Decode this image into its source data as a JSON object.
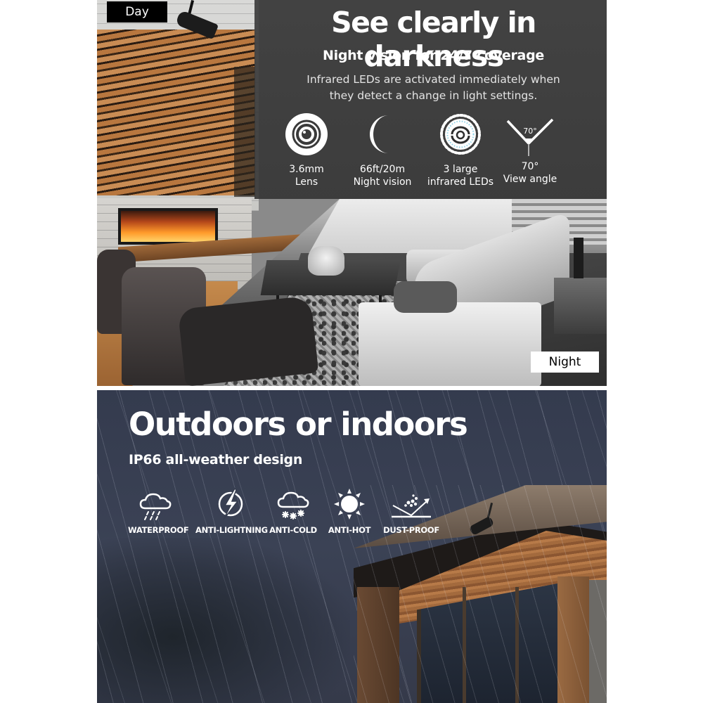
{
  "top_panel": {
    "day_label": "Day",
    "night_label": "Night",
    "headline": "See clearly in darkness",
    "subheadline": "Night vision for 24/7 coverage",
    "description_line1": "Infrared LEDs are activated immediately when",
    "description_line2": "they detect a change in light settings.",
    "features": [
      {
        "icon": "camera-lens-icon",
        "line1": "3.6mm",
        "line2": "Lens"
      },
      {
        "icon": "crescent-moon-icon",
        "line1": "66ft/20m",
        "line2": "Night vision"
      },
      {
        "icon": "infrared-led-ring-icon",
        "line1": "3 large",
        "line2": "infrared LEDs"
      },
      {
        "icon": "view-angle-icon",
        "line1": "70°",
        "line2": "View angle",
        "angle_badge": "70°"
      }
    ]
  },
  "bottom_panel": {
    "headline": "Outdoors or indoors",
    "subheadline": "IP66 all-weather design",
    "features": [
      {
        "icon": "rain-cloud-icon",
        "label": "WATERPROOF"
      },
      {
        "icon": "lightning-icon",
        "label": "ANTI-LIGHTNING"
      },
      {
        "icon": "snow-cloud-icon",
        "label": "ANTI-COLD"
      },
      {
        "icon": "sun-icon",
        "label": "ANTI-HOT"
      },
      {
        "icon": "dust-deflect-icon",
        "label": "DUST-PROOF"
      }
    ]
  },
  "colors": {
    "overlay": "#3a3a3a",
    "sky": "#363d4f",
    "wood": "#b8773f",
    "text": "#ffffff",
    "led_accent": "#8fd3e8"
  }
}
